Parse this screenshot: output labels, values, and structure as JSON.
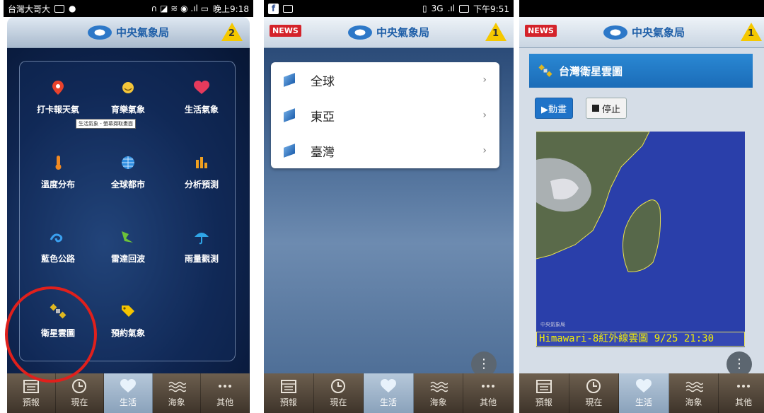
{
  "phone1": {
    "status": {
      "carrier": "台灣大哥大",
      "time": "晚上9:18"
    },
    "app_title": "中央氣象局",
    "alert_count": "2",
    "tooltip": "生活氣象 - 螢幕擷取畫面",
    "grid": [
      {
        "label": "打卡報天氣",
        "icon": "location-pin-icon"
      },
      {
        "label": "育樂氣象",
        "icon": "sun-icon"
      },
      {
        "label": "生活氣象",
        "icon": "heart-icon"
      },
      {
        "label": "溫度分布",
        "icon": "thermometer-icon"
      },
      {
        "label": "全球都市",
        "icon": "globe-icon"
      },
      {
        "label": "分析預測",
        "icon": "bar-chart-icon"
      },
      {
        "label": "藍色公路",
        "icon": "wave-icon"
      },
      {
        "label": "雷達回波",
        "icon": "radar-icon"
      },
      {
        "label": "雨量觀測",
        "icon": "umbrella-icon"
      },
      {
        "label": "衛星雲圖",
        "icon": "satellite-icon"
      },
      {
        "label": "預約氣象",
        "icon": "tag-icon"
      }
    ]
  },
  "phone2": {
    "status": {
      "network": "3G",
      "time": "下午9:51"
    },
    "news_label": "NEWS",
    "app_title": "中央氣象局",
    "alert_count": "1",
    "menu": [
      {
        "label": "全球"
      },
      {
        "label": "東亞"
      },
      {
        "label": "臺灣"
      }
    ],
    "fab_label": "⋮"
  },
  "phone3": {
    "news_label": "NEWS",
    "app_title": "中央氣象局",
    "alert_count": "1",
    "section_title": "台灣衛星雲圖",
    "play_label": "▶動畫",
    "stop_label": "停止",
    "image_caption": "Himawari-8紅外線雲圖 9/25 21:30",
    "watermark": "中央氣象局",
    "fab_label": "⋮"
  },
  "tabs": [
    {
      "label": "預報",
      "icon": "calendar-icon"
    },
    {
      "label": "現在",
      "icon": "clock-icon"
    },
    {
      "label": "生活",
      "icon": "heart-icon"
    },
    {
      "label": "海象",
      "icon": "wave-icon"
    },
    {
      "label": "其他",
      "icon": "more-icon"
    }
  ],
  "colors": {
    "alert": "#f5c800",
    "news": "#d4232a",
    "accent": "#1f73c8",
    "highlight_circle": "#e0201c"
  }
}
